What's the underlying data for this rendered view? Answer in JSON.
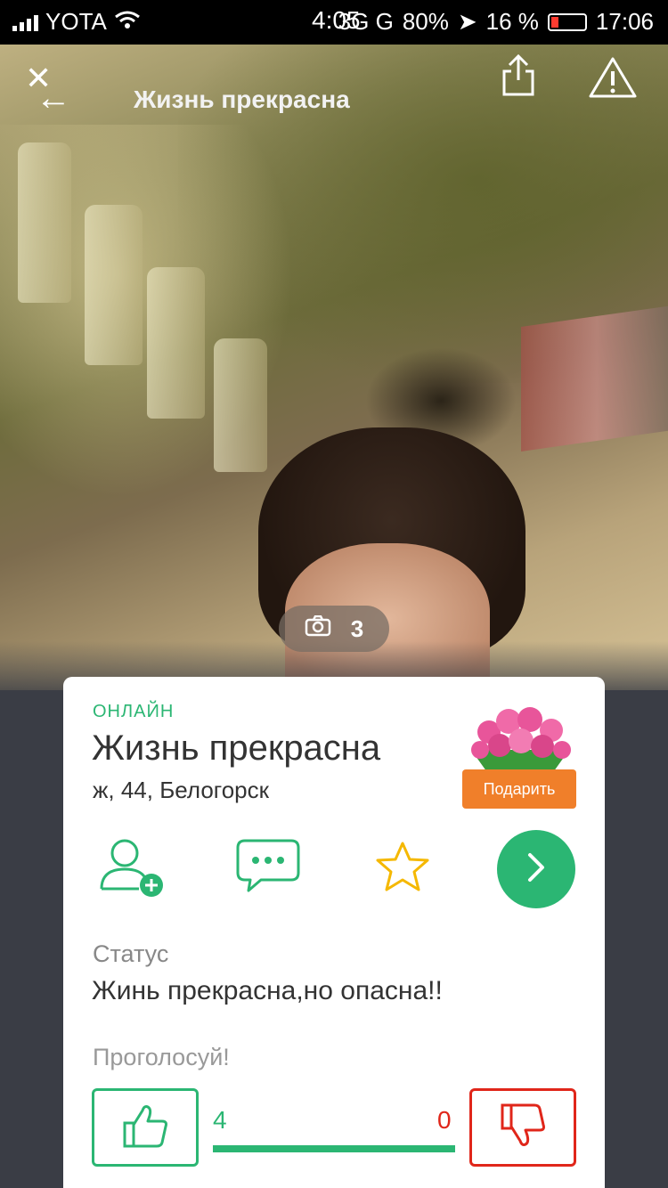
{
  "status_bar": {
    "carrier": "YOTA",
    "time": "4:05",
    "network": "3G G",
    "battery_left": "80%",
    "location_battery": "16 %",
    "clock_right": "17:06"
  },
  "header": {
    "title": "Жизнь прекрасна"
  },
  "photo": {
    "count": "3"
  },
  "profile": {
    "online_label": "ОНЛАЙН",
    "name": "Жизнь прекрасна",
    "meta": "ж, 44, Белогорск",
    "gift_button": "Подарить"
  },
  "status": {
    "label": "Статус",
    "text": "Жинь прекрасна,но опасна!!"
  },
  "vote": {
    "label": "Проголосуй!",
    "likes": "4",
    "dislikes": "0",
    "like_fraction": 1.0
  },
  "colors": {
    "accent_green": "#2bb673",
    "accent_red": "#e0261a",
    "gift_orange": "#f07f2a"
  },
  "icons": [
    "close-icon",
    "back-arrow-icon",
    "share-icon",
    "report-icon",
    "camera-icon",
    "add-friend-icon",
    "message-icon",
    "star-icon",
    "chevron-right-icon",
    "thumbs-up-icon",
    "thumbs-down-icon"
  ]
}
